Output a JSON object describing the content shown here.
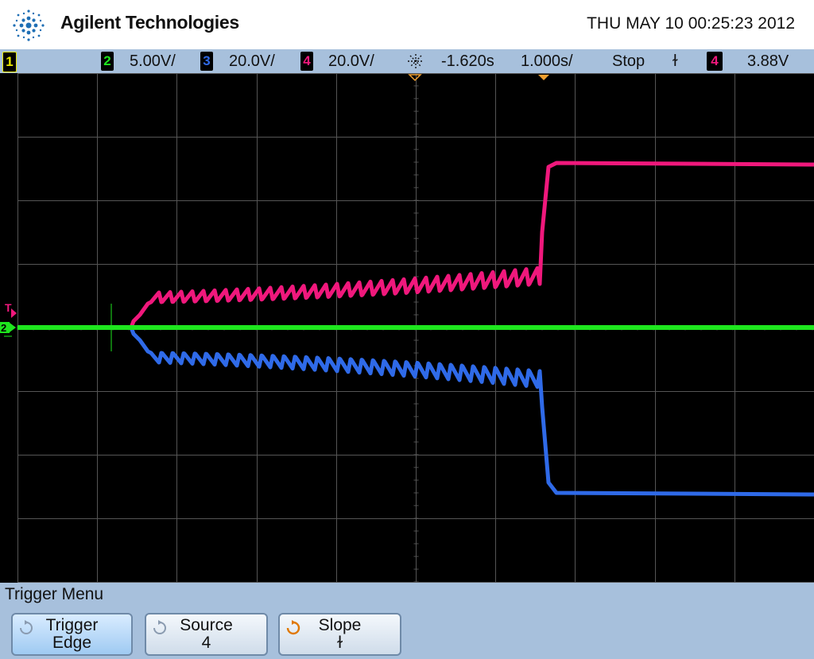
{
  "header": {
    "brand": "Agilent Technologies",
    "datetime": "THU MAY 10 00:25:23 2012",
    "logo_icon": "agilent-spark-logo-icon"
  },
  "status_bar": {
    "ch1_label": "1",
    "ch2_label": "2",
    "ch2_scale": "5.00V/",
    "ch3_label": "3",
    "ch3_scale": "20.0V/",
    "ch4_label": "4",
    "ch4_scale": "20.0V/",
    "trigger_delay_icon": "trigger-delay-icon",
    "delay": "-1.620s",
    "timebase": "1.000s/",
    "run_state": "Stop",
    "slope_symbol": "ɫ",
    "trig_source_label": "4",
    "trig_level": "3.88V"
  },
  "screen": {
    "trigger_marker": "T",
    "ch2_marker": "2",
    "colors": {
      "ch1": "#e8e800",
      "ch2": "#1ee61e",
      "ch3": "#2f6ae8",
      "ch4": "#f0187c",
      "grid": "#555555",
      "trigger_marker": "#f0a030"
    }
  },
  "menu": {
    "title": "Trigger Menu",
    "softkeys": [
      {
        "line1": "Trigger",
        "line2": "Edge",
        "icon": "rotary-knob-icon"
      },
      {
        "line1": "Source",
        "line2": "4",
        "icon": "rotary-knob-icon"
      },
      {
        "line1": "Slope",
        "line2": "ɫ",
        "icon": "rotary-knob-orange-icon"
      }
    ]
  }
}
